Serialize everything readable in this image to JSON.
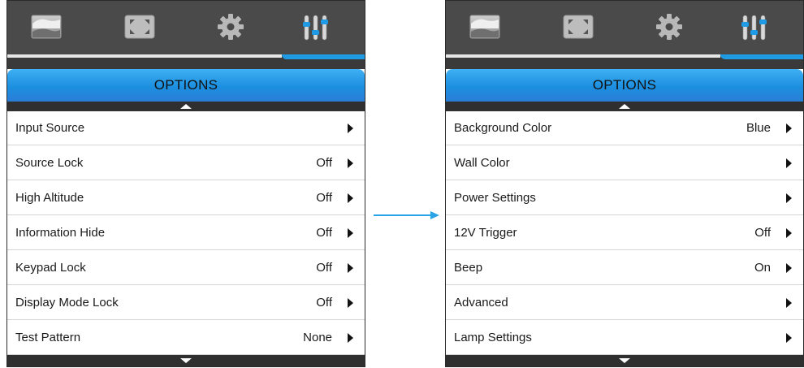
{
  "icons": [
    "image-icon",
    "screen-fit-icon",
    "gear-icon",
    "sliders-icon"
  ],
  "colors": {
    "accent": "#1f9be6",
    "iconbar": "#4a4a4a",
    "arrow": "#29a3e8"
  },
  "panels": [
    {
      "title": "OPTIONS",
      "items": [
        {
          "label": "Input Source",
          "value": ""
        },
        {
          "label": "Source Lock",
          "value": "Off"
        },
        {
          "label": "High Altitude",
          "value": "Off"
        },
        {
          "label": "Information Hide",
          "value": "Off"
        },
        {
          "label": "Keypad Lock",
          "value": "Off"
        },
        {
          "label": "Display Mode Lock",
          "value": "Off"
        },
        {
          "label": "Test Pattern",
          "value": "None"
        }
      ]
    },
    {
      "title": "OPTIONS",
      "items": [
        {
          "label": "Background Color",
          "value": "Blue"
        },
        {
          "label": "Wall Color",
          "value": ""
        },
        {
          "label": "Power Settings",
          "value": ""
        },
        {
          "label": "12V Trigger",
          "value": "Off"
        },
        {
          "label": "Beep",
          "value": "On"
        },
        {
          "label": "Advanced",
          "value": ""
        },
        {
          "label": "Lamp Settings",
          "value": ""
        }
      ]
    }
  ]
}
